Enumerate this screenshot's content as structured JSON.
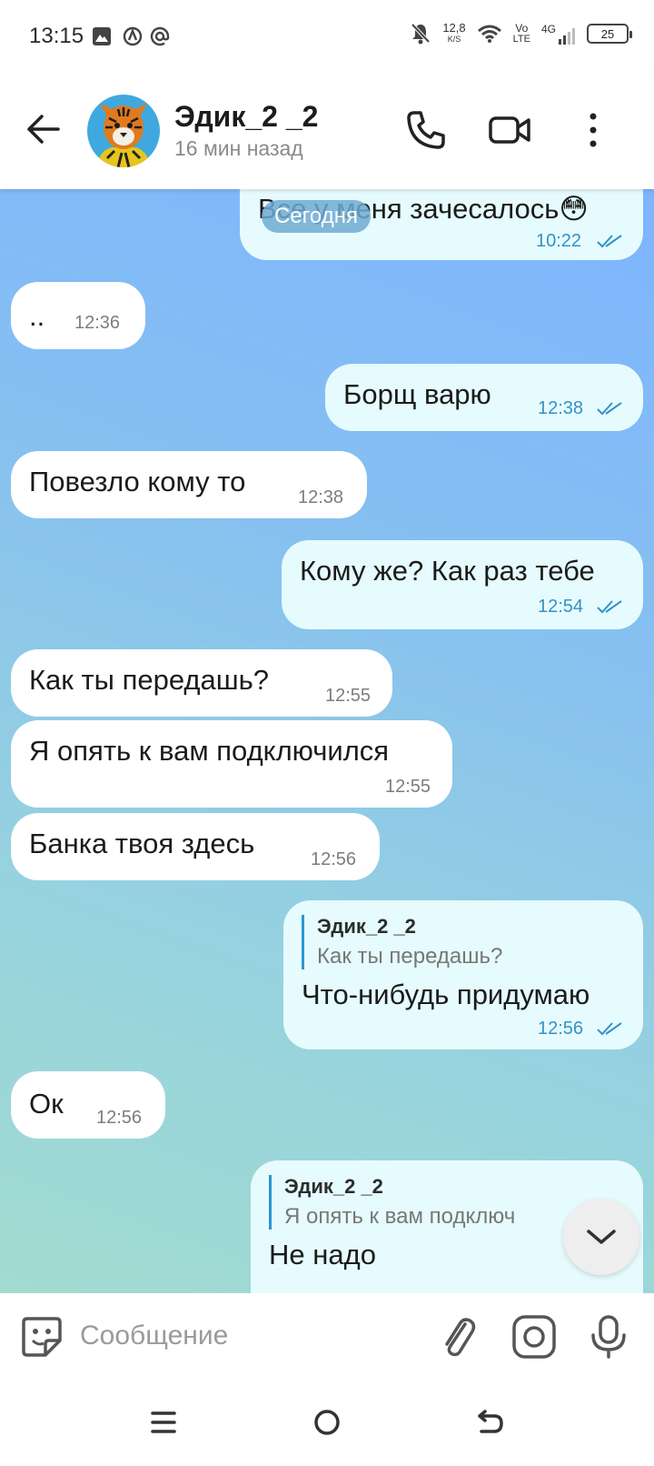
{
  "status_bar": {
    "time": "13:15",
    "net_speed_value": "12,8",
    "net_speed_unit": "K/S",
    "volte_top": "Vo",
    "volte_bottom": "LTE",
    "network_type": "4G",
    "battery": "25"
  },
  "header": {
    "contact_name": "Эдик_2 _2",
    "last_seen": "16 мин назад",
    "icons": [
      "back-arrow-icon",
      "phone-icon",
      "video-camera-icon",
      "more-vert-icon"
    ]
  },
  "chat": {
    "date_chip": "Сегодня",
    "messages": [
      {
        "direction": "out",
        "text": "Все у меня зачесалось😳",
        "time": "10:22",
        "read": true
      },
      {
        "direction": "in",
        "text": "..",
        "time": "12:36"
      },
      {
        "direction": "out",
        "text": "Борщ варю",
        "time": "12:38",
        "read": true
      },
      {
        "direction": "in",
        "text": "Повезло кому то",
        "time": "12:38"
      },
      {
        "direction": "out",
        "text": "Кому же? Как раз тебе",
        "time": "12:54",
        "read": true
      },
      {
        "direction": "in",
        "text": "Как ты передашь?",
        "time": "12:55"
      },
      {
        "direction": "in",
        "text": "Я опять к вам подключился",
        "time": "12:55"
      },
      {
        "direction": "in",
        "text": "Банка твоя здесь",
        "time": "12:56"
      },
      {
        "direction": "out",
        "reply_name": "Эдик_2 _2",
        "reply_text": "Как ты передашь?",
        "text": "Что-нибудь придумаю",
        "time": "12:56",
        "read": true
      },
      {
        "direction": "in",
        "text": "Ок",
        "time": "12:56"
      },
      {
        "direction": "out",
        "reply_name": "Эдик_2 _2",
        "reply_text": "Я опять к вам подключ",
        "text": "Не надо"
      }
    ]
  },
  "input": {
    "placeholder": "Сообщение",
    "icons": [
      "sticker-icon",
      "paperclip-icon",
      "camera-icon",
      "microphone-icon"
    ]
  },
  "colors": {
    "outgoing_bubble": "#e6fbfd",
    "incoming_bubble": "#ffffff",
    "accent": "#3392c8",
    "chat_bg_top": "#7db5ff",
    "chat_bg_bottom": "#a2dbd0"
  }
}
